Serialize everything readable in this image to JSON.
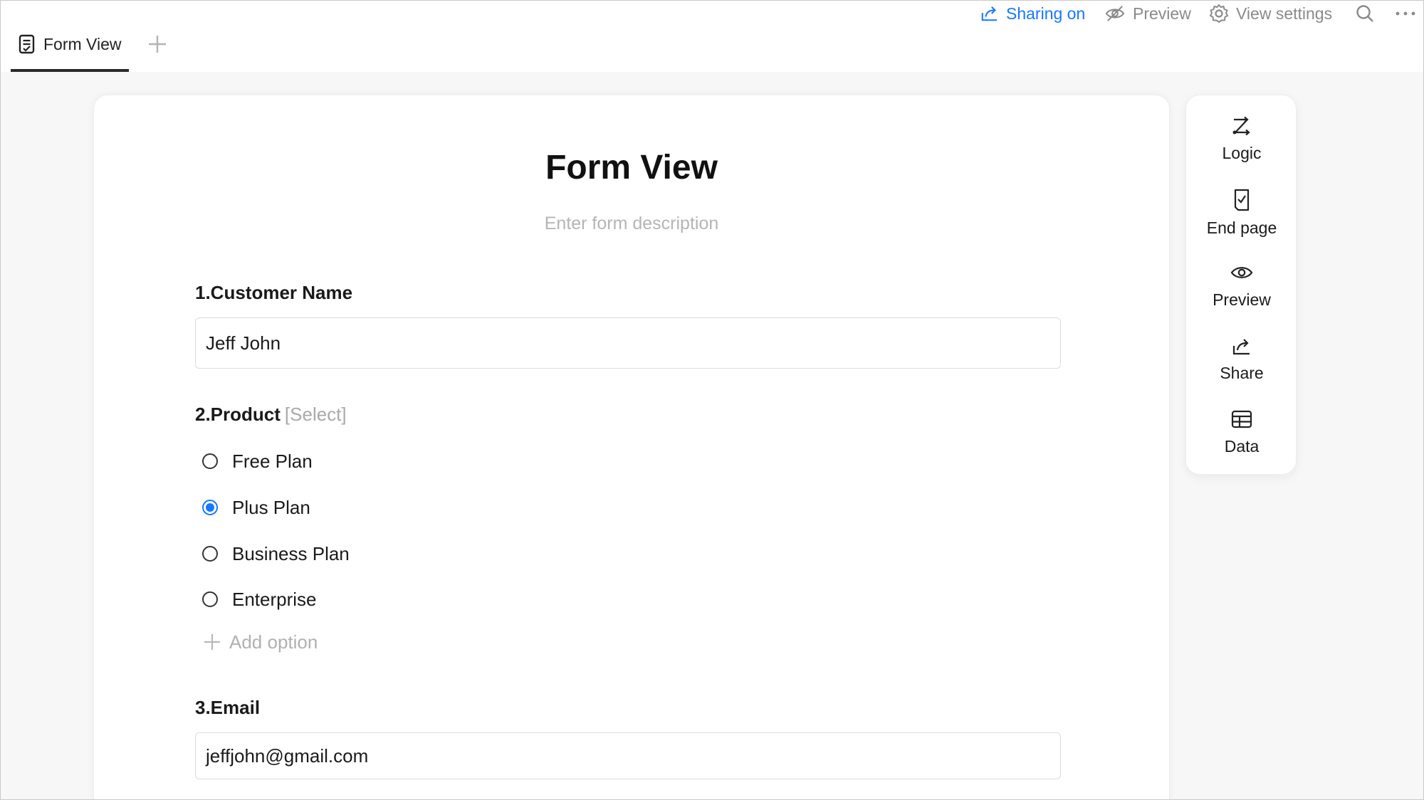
{
  "tabs": [
    {
      "label": "Form View",
      "active": true
    }
  ],
  "toolbar": {
    "sharing_label": "Sharing on",
    "preview_label": "Preview",
    "view_settings_label": "View settings"
  },
  "form": {
    "title": "Form View",
    "description_placeholder": "Enter form description",
    "questions": {
      "q1": {
        "label": "1.Customer Name",
        "value": "Jeff John"
      },
      "q2": {
        "label": "2.Product",
        "type": "[Select]",
        "options": [
          "Free Plan",
          "Plus Plan",
          "Business Plan",
          "Enterprise"
        ],
        "selected": "Plus Plan",
        "add_option_label": "Add option"
      },
      "q3": {
        "label": "3.Email",
        "value": "jeffjohn@gmail.com"
      }
    }
  },
  "side_panel": {
    "items": [
      "Logic",
      "End page",
      "Preview",
      "Share",
      "Data"
    ]
  },
  "colors": {
    "accent": "#1677ff",
    "muted": "#8a8a8a",
    "placeholder": "#b5b5b5"
  },
  "icons": {
    "tab": "form-icon",
    "toolbar": [
      "share-icon",
      "eye-off-icon",
      "gear-icon",
      "search-icon",
      "more-icon"
    ],
    "side": [
      "logic-icon",
      "end-page-icon",
      "eye-icon",
      "share-icon",
      "table-icon"
    ]
  }
}
